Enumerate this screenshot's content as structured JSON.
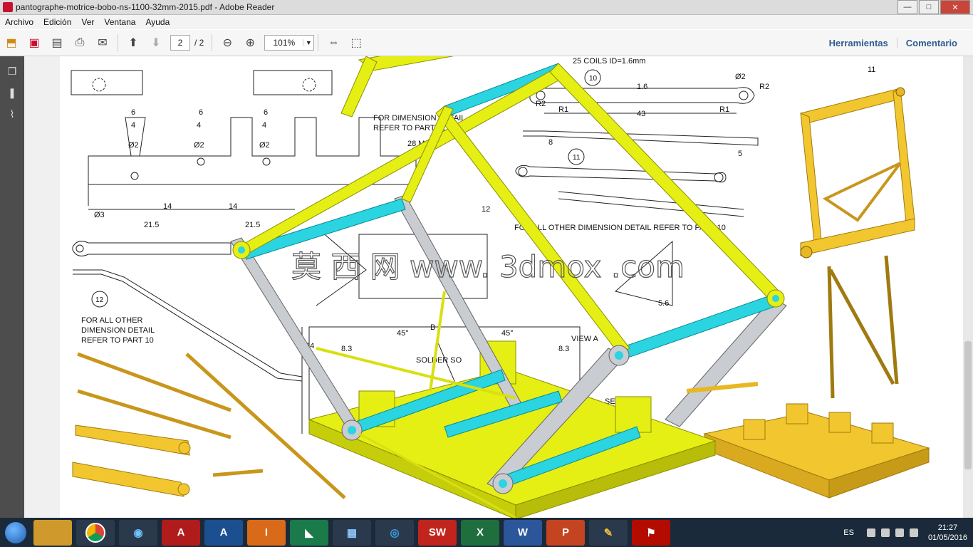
{
  "window": {
    "title": "pantographe-motrice-bobo-ns-1100-32mm-2015.pdf - Adobe Reader",
    "minimize": "—",
    "maximize": "□",
    "close": "✕"
  },
  "menu": [
    "Archivo",
    "Edición",
    "Ver",
    "Ventana",
    "Ayuda"
  ],
  "toolbar": {
    "page_current": "2",
    "page_total": "/ 2",
    "zoom": "101%",
    "tools_label": "Herramientas",
    "comment_label": "Comentario"
  },
  "drawing": {
    "labels": {
      "dim_6": "6",
      "dim_4": "4",
      "dim_phi2": "Ø2",
      "dim_phi3": "Ø3",
      "dim_14": "14",
      "dim_215": "21.5",
      "dim_12": "12",
      "dim_43": "43",
      "dim_8": "8",
      "dim_5": "5",
      "dim_3": "3",
      "dim_11": "11",
      "dim_16": "1.6",
      "dim_24": "24",
      "dim_83": "8.3",
      "dim_45": "45°",
      "r1": "R1",
      "r2": "R2",
      "coils": "25 COILS   ID=1.6mm",
      "part10": "10",
      "part11": "11",
      "part12": "12",
      "for_dim_02": "FOR DIMENSION DETAIL",
      "refer_02": "REFER TO PART 02",
      "max28": "28 MAX",
      "for_other_10": "FOR ALL OTHER DIMENSION DETAIL REFER TO PART 10",
      "for_all_other_1": "FOR ALL OTHER",
      "for_all_other_2": "DIMENSION DETAIL",
      "for_all_other_3": "REFER TO PART 10",
      "view_a": "VIEW A",
      "b": "B",
      "section": "SECT",
      "solder": "SOLDER SO",
      "dim_56": "5.6"
    },
    "watermark": "莫 西 网 www. 3dmox .com",
    "colors": {
      "yellow": "#e6ef14",
      "cyan": "#2ad4e0",
      "gray": "#c9ccd0",
      "gold": "#f2c62e"
    }
  },
  "taskbar": {
    "apps": [
      {
        "icon": "file-explorer-icon",
        "text": ""
      },
      {
        "icon": "chrome-icon",
        "text": ""
      },
      {
        "icon": "app-icon",
        "text": ""
      },
      {
        "icon": "autocad-icon",
        "text": "A"
      },
      {
        "icon": "autodesk-icon",
        "text": "A"
      },
      {
        "icon": "inventor-icon",
        "text": "I"
      },
      {
        "icon": "green-app-icon",
        "text": ""
      },
      {
        "icon": "revit-icon",
        "text": ""
      },
      {
        "icon": "keyshot-icon",
        "text": ""
      },
      {
        "icon": "solidworks-icon",
        "text": "SW"
      },
      {
        "icon": "excel-icon",
        "text": "X"
      },
      {
        "icon": "word-icon",
        "text": "W"
      },
      {
        "icon": "powerpoint-icon",
        "text": "P"
      },
      {
        "icon": "paint-icon",
        "text": ""
      },
      {
        "icon": "acrobat-icon",
        "text": ""
      }
    ],
    "language": "ES",
    "time": "21:27",
    "date": "01/05/2016"
  }
}
